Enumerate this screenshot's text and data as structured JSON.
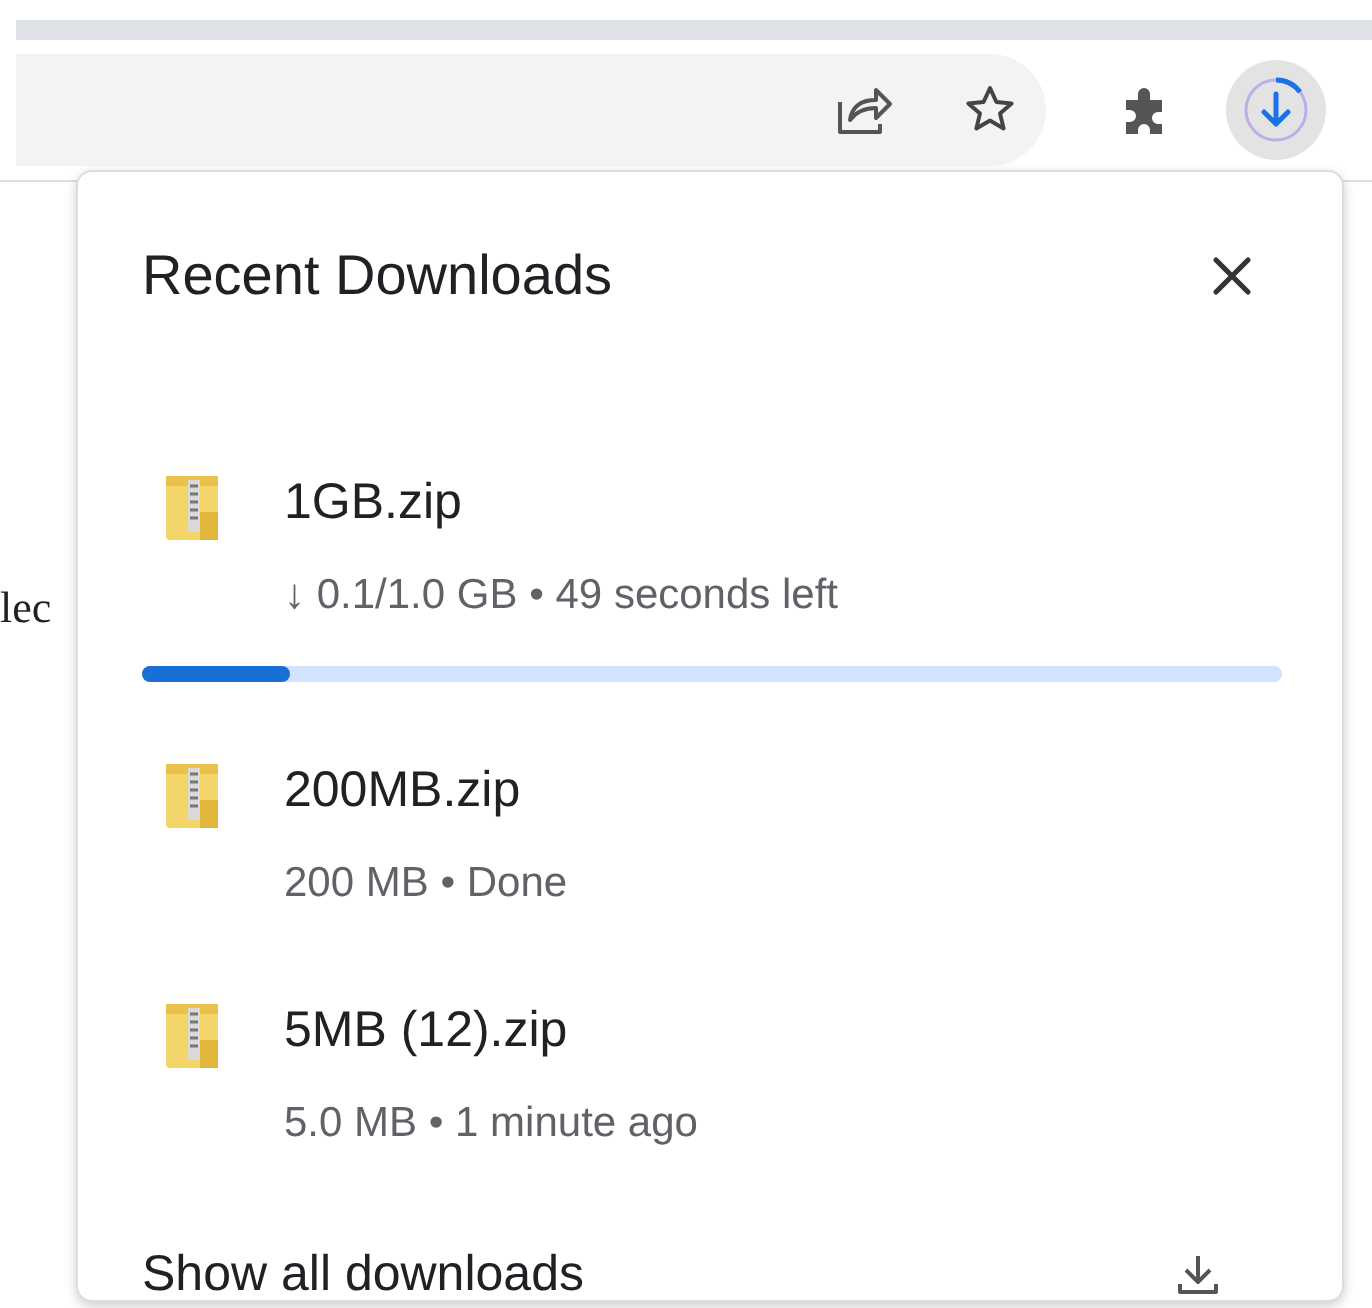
{
  "page_text": "lec",
  "downloads_panel": {
    "title": "Recent Downloads",
    "items": [
      {
        "name": "1GB.zip",
        "status": "↓ 0.1/1.0 GB • 49 seconds left",
        "kind": "progress",
        "level": 0.13
      },
      {
        "name": "200MB.zip",
        "status": "200 MB • Done",
        "kind": "done"
      },
      {
        "name": "5MB (12).zip",
        "status": "5.0 MB • 1 minute ago",
        "kind": "done"
      }
    ],
    "footer": "Show all downloads"
  }
}
